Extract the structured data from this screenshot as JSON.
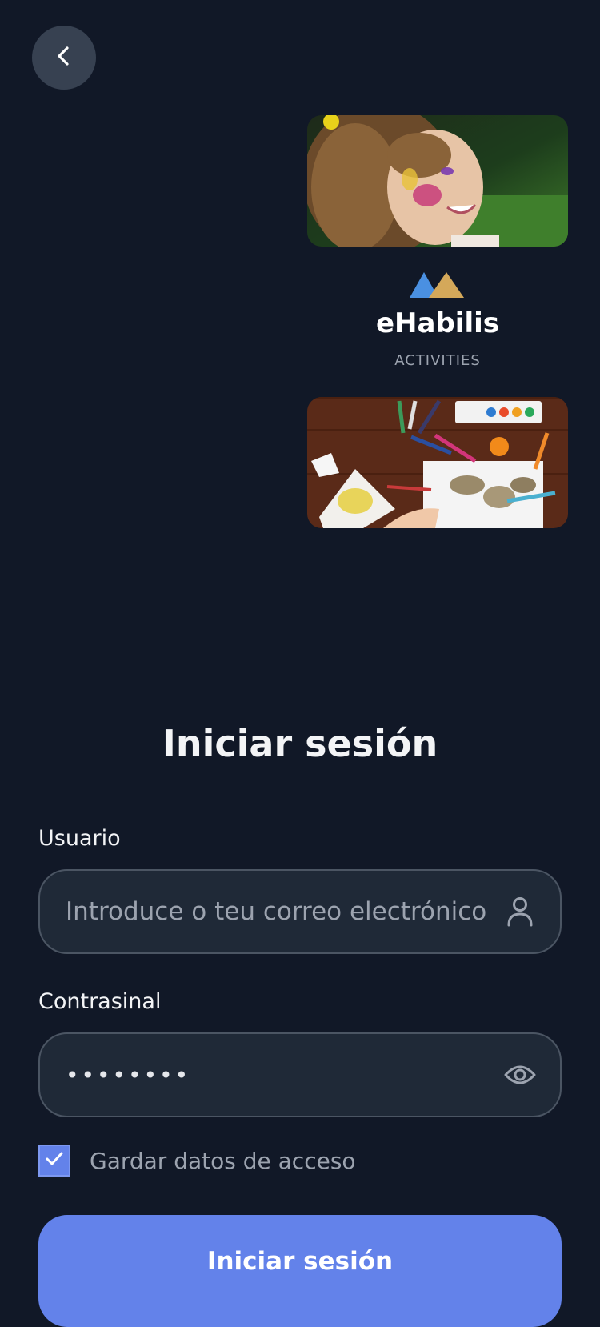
{
  "header": {
    "back_icon": "chevron-left-icon"
  },
  "brand": {
    "name": "eHabilis",
    "subtitle": "ACTIVITIES",
    "logo_colors": [
      "#4a90e2",
      "#d4a85a"
    ]
  },
  "login": {
    "title": "Iniciar sesión",
    "username": {
      "label": "Usuario",
      "placeholder": "Introduce o teu correo electrónico",
      "value": "",
      "icon": "user-icon"
    },
    "password": {
      "label": "Contrasinal",
      "value": "••••••••",
      "icon": "eye-icon"
    },
    "remember": {
      "label": "Gardar datos de acceso",
      "checked": true
    },
    "submit_label": "Iniciar sesión"
  },
  "colors": {
    "background": "#111827",
    "accent": "#6382ea",
    "field_bg": "#1f2937",
    "field_border": "#4b5563"
  }
}
